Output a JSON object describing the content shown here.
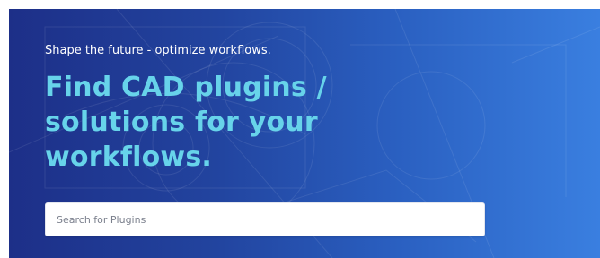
{
  "hero": {
    "tagline": "Shape the future - optimize workflows.",
    "headline_lines": [
      "Find CAD plugins /",
      "solutions for your",
      "workflows."
    ]
  },
  "search": {
    "placeholder": "Search for Plugins",
    "value": ""
  },
  "colors": {
    "hero_gradient_start": "#1d2f88",
    "hero_gradient_end": "#3a7fe0",
    "headline_accent": "#67d3ea",
    "tagline_text": "#ffffff",
    "search_background": "#ffffff"
  }
}
